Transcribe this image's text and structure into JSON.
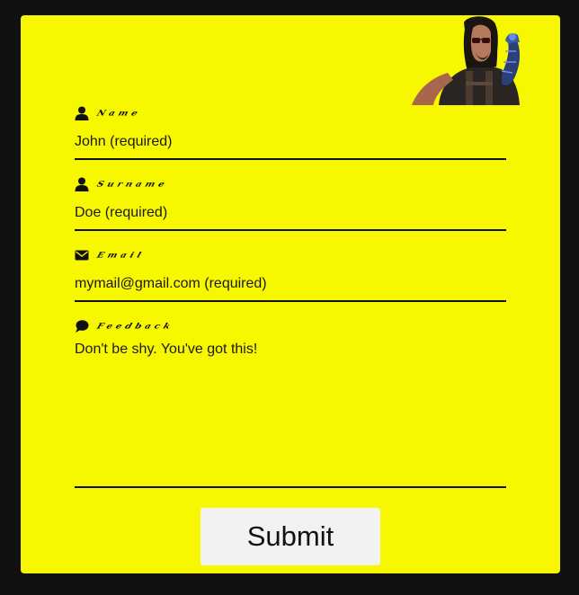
{
  "form": {
    "fields": [
      {
        "label": "Name",
        "icon": "user-icon",
        "placeholder": "John (required)",
        "type": "text"
      },
      {
        "label": "Surname",
        "icon": "user-icon",
        "placeholder": "Doe (required)",
        "type": "text"
      },
      {
        "label": "Email",
        "icon": "envelope-icon",
        "placeholder": "mymail@gmail.com (required)",
        "type": "email"
      },
      {
        "label": "Feedback",
        "icon": "comment-icon",
        "placeholder": "Don't be shy. You've got this!",
        "type": "textarea"
      }
    ],
    "submit_label": "Submit"
  },
  "colors": {
    "background": "#111111",
    "card": "#f7f700",
    "button": "#f2f2f2"
  },
  "avatar": {
    "icon": "character-portrait"
  }
}
